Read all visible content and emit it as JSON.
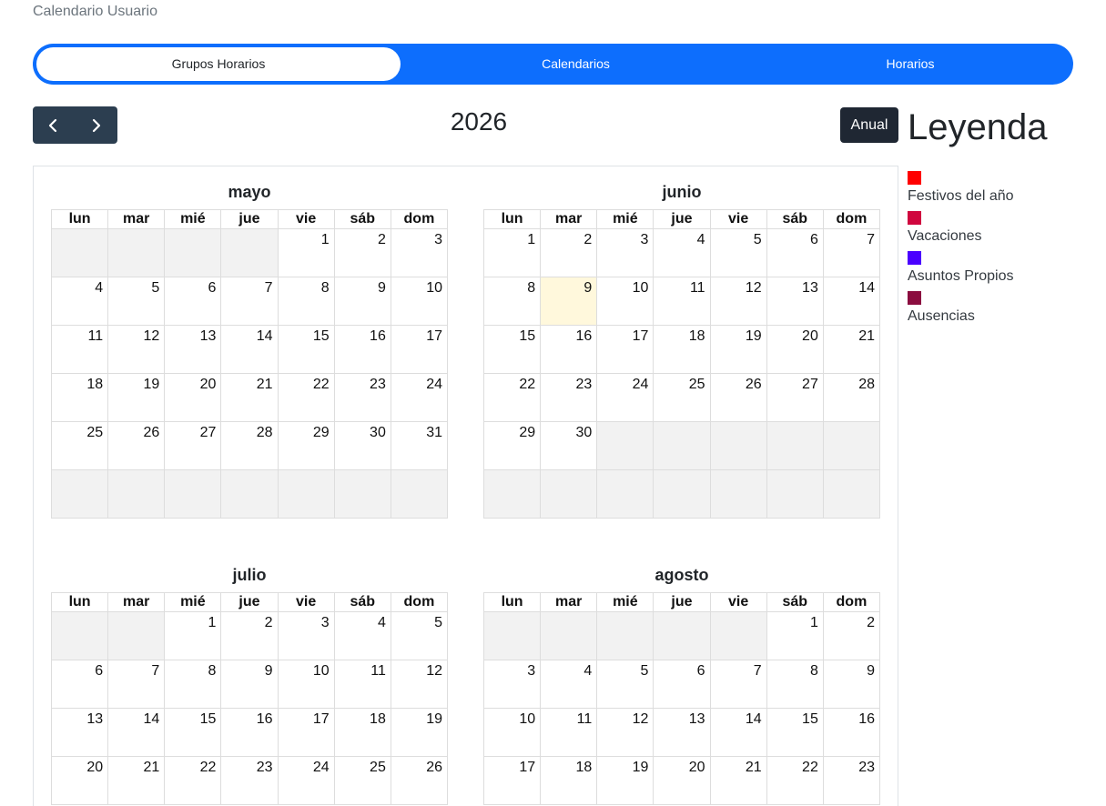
{
  "header": {
    "title": "Calendario Usuario"
  },
  "tabs": [
    {
      "label": "Grupos Horarios",
      "active": true
    },
    {
      "label": "Calendarios",
      "active": false
    },
    {
      "label": "Horarios",
      "active": false
    }
  ],
  "toolbar": {
    "prev_icon": "chevron-left-icon",
    "next_icon": "chevron-right-icon",
    "year": "2026",
    "view_button": "Anual"
  },
  "legend": {
    "title": "Leyenda",
    "items": [
      {
        "label": "Festivos del año",
        "color": "#ff0000"
      },
      {
        "label": "Vacaciones",
        "color": "#d0063e"
      },
      {
        "label": "Asuntos Propios",
        "color": "#4a00ff"
      },
      {
        "label": "Ausencias",
        "color": "#8b0d3f"
      }
    ]
  },
  "calendar": {
    "weekdays": [
      "lun",
      "mar",
      "mié",
      "jue",
      "vie",
      "sáb",
      "dom"
    ],
    "colors": {
      "empty_cell": "#f2f2f2",
      "today_cell": "#fff8dc",
      "accent": "#0d6efd"
    },
    "months": [
      {
        "name": "mayo",
        "weeks": [
          [
            null,
            null,
            null,
            null,
            1,
            2,
            3
          ],
          [
            4,
            5,
            6,
            7,
            8,
            9,
            10
          ],
          [
            11,
            12,
            13,
            14,
            15,
            16,
            17
          ],
          [
            18,
            19,
            20,
            21,
            22,
            23,
            24
          ],
          [
            25,
            26,
            27,
            28,
            29,
            30,
            31
          ],
          [
            null,
            null,
            null,
            null,
            null,
            null,
            null
          ]
        ]
      },
      {
        "name": "junio",
        "today": 9,
        "weeks": [
          [
            1,
            2,
            3,
            4,
            5,
            6,
            7
          ],
          [
            8,
            9,
            10,
            11,
            12,
            13,
            14
          ],
          [
            15,
            16,
            17,
            18,
            19,
            20,
            21
          ],
          [
            22,
            23,
            24,
            25,
            26,
            27,
            28
          ],
          [
            29,
            30,
            null,
            null,
            null,
            null,
            null
          ],
          [
            null,
            null,
            null,
            null,
            null,
            null,
            null
          ]
        ]
      },
      {
        "name": "julio",
        "weeks": [
          [
            null,
            null,
            1,
            2,
            3,
            4,
            5
          ],
          [
            6,
            7,
            8,
            9,
            10,
            11,
            12
          ],
          [
            13,
            14,
            15,
            16,
            17,
            18,
            19
          ],
          [
            20,
            21,
            22,
            23,
            24,
            25,
            26
          ]
        ]
      },
      {
        "name": "agosto",
        "weeks": [
          [
            null,
            null,
            null,
            null,
            null,
            1,
            2
          ],
          [
            3,
            4,
            5,
            6,
            7,
            8,
            9
          ],
          [
            10,
            11,
            12,
            13,
            14,
            15,
            16
          ],
          [
            17,
            18,
            19,
            20,
            21,
            22,
            23
          ]
        ]
      }
    ]
  }
}
